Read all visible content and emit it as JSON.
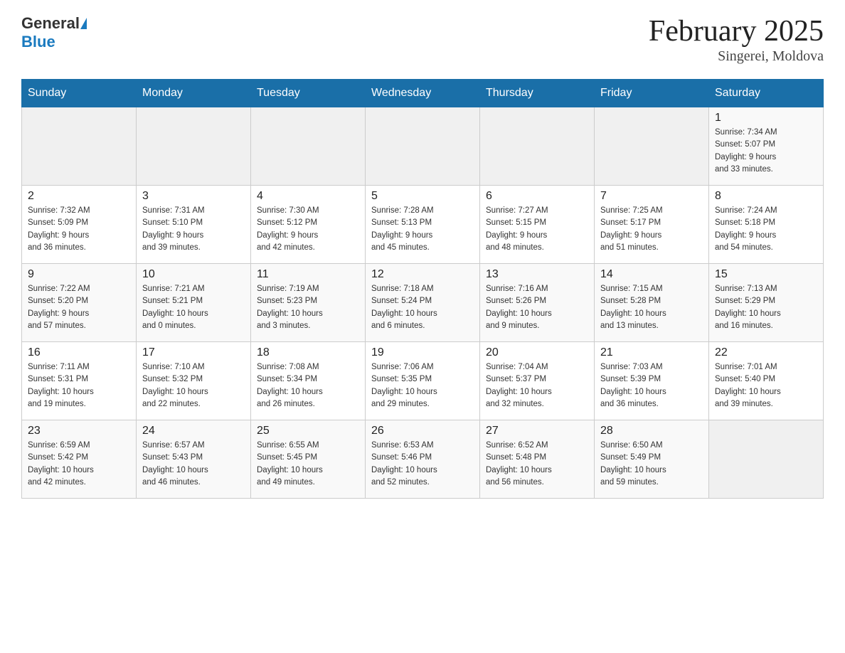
{
  "header": {
    "logo_general": "General",
    "logo_blue": "Blue",
    "month_title": "February 2025",
    "location": "Singerei, Moldova"
  },
  "weekdays": [
    "Sunday",
    "Monday",
    "Tuesday",
    "Wednesday",
    "Thursday",
    "Friday",
    "Saturday"
  ],
  "weeks": [
    [
      {
        "day": "",
        "info": ""
      },
      {
        "day": "",
        "info": ""
      },
      {
        "day": "",
        "info": ""
      },
      {
        "day": "",
        "info": ""
      },
      {
        "day": "",
        "info": ""
      },
      {
        "day": "",
        "info": ""
      },
      {
        "day": "1",
        "info": "Sunrise: 7:34 AM\nSunset: 5:07 PM\nDaylight: 9 hours\nand 33 minutes."
      }
    ],
    [
      {
        "day": "2",
        "info": "Sunrise: 7:32 AM\nSunset: 5:09 PM\nDaylight: 9 hours\nand 36 minutes."
      },
      {
        "day": "3",
        "info": "Sunrise: 7:31 AM\nSunset: 5:10 PM\nDaylight: 9 hours\nand 39 minutes."
      },
      {
        "day": "4",
        "info": "Sunrise: 7:30 AM\nSunset: 5:12 PM\nDaylight: 9 hours\nand 42 minutes."
      },
      {
        "day": "5",
        "info": "Sunrise: 7:28 AM\nSunset: 5:13 PM\nDaylight: 9 hours\nand 45 minutes."
      },
      {
        "day": "6",
        "info": "Sunrise: 7:27 AM\nSunset: 5:15 PM\nDaylight: 9 hours\nand 48 minutes."
      },
      {
        "day": "7",
        "info": "Sunrise: 7:25 AM\nSunset: 5:17 PM\nDaylight: 9 hours\nand 51 minutes."
      },
      {
        "day": "8",
        "info": "Sunrise: 7:24 AM\nSunset: 5:18 PM\nDaylight: 9 hours\nand 54 minutes."
      }
    ],
    [
      {
        "day": "9",
        "info": "Sunrise: 7:22 AM\nSunset: 5:20 PM\nDaylight: 9 hours\nand 57 minutes."
      },
      {
        "day": "10",
        "info": "Sunrise: 7:21 AM\nSunset: 5:21 PM\nDaylight: 10 hours\nand 0 minutes."
      },
      {
        "day": "11",
        "info": "Sunrise: 7:19 AM\nSunset: 5:23 PM\nDaylight: 10 hours\nand 3 minutes."
      },
      {
        "day": "12",
        "info": "Sunrise: 7:18 AM\nSunset: 5:24 PM\nDaylight: 10 hours\nand 6 minutes."
      },
      {
        "day": "13",
        "info": "Sunrise: 7:16 AM\nSunset: 5:26 PM\nDaylight: 10 hours\nand 9 minutes."
      },
      {
        "day": "14",
        "info": "Sunrise: 7:15 AM\nSunset: 5:28 PM\nDaylight: 10 hours\nand 13 minutes."
      },
      {
        "day": "15",
        "info": "Sunrise: 7:13 AM\nSunset: 5:29 PM\nDaylight: 10 hours\nand 16 minutes."
      }
    ],
    [
      {
        "day": "16",
        "info": "Sunrise: 7:11 AM\nSunset: 5:31 PM\nDaylight: 10 hours\nand 19 minutes."
      },
      {
        "day": "17",
        "info": "Sunrise: 7:10 AM\nSunset: 5:32 PM\nDaylight: 10 hours\nand 22 minutes."
      },
      {
        "day": "18",
        "info": "Sunrise: 7:08 AM\nSunset: 5:34 PM\nDaylight: 10 hours\nand 26 minutes."
      },
      {
        "day": "19",
        "info": "Sunrise: 7:06 AM\nSunset: 5:35 PM\nDaylight: 10 hours\nand 29 minutes."
      },
      {
        "day": "20",
        "info": "Sunrise: 7:04 AM\nSunset: 5:37 PM\nDaylight: 10 hours\nand 32 minutes."
      },
      {
        "day": "21",
        "info": "Sunrise: 7:03 AM\nSunset: 5:39 PM\nDaylight: 10 hours\nand 36 minutes."
      },
      {
        "day": "22",
        "info": "Sunrise: 7:01 AM\nSunset: 5:40 PM\nDaylight: 10 hours\nand 39 minutes."
      }
    ],
    [
      {
        "day": "23",
        "info": "Sunrise: 6:59 AM\nSunset: 5:42 PM\nDaylight: 10 hours\nand 42 minutes."
      },
      {
        "day": "24",
        "info": "Sunrise: 6:57 AM\nSunset: 5:43 PM\nDaylight: 10 hours\nand 46 minutes."
      },
      {
        "day": "25",
        "info": "Sunrise: 6:55 AM\nSunset: 5:45 PM\nDaylight: 10 hours\nand 49 minutes."
      },
      {
        "day": "26",
        "info": "Sunrise: 6:53 AM\nSunset: 5:46 PM\nDaylight: 10 hours\nand 52 minutes."
      },
      {
        "day": "27",
        "info": "Sunrise: 6:52 AM\nSunset: 5:48 PM\nDaylight: 10 hours\nand 56 minutes."
      },
      {
        "day": "28",
        "info": "Sunrise: 6:50 AM\nSunset: 5:49 PM\nDaylight: 10 hours\nand 59 minutes."
      },
      {
        "day": "",
        "info": ""
      }
    ]
  ]
}
